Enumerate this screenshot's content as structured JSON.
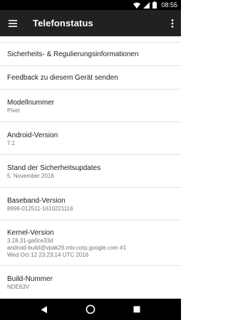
{
  "status_bar": {
    "time": "08:55",
    "icons": [
      "wifi-icon",
      "signal-icon",
      "battery-icon"
    ]
  },
  "app_bar": {
    "title": "Telefonstatus",
    "menu_icon": "hamburger-menu-icon",
    "overflow_icon": "more-vert-icon"
  },
  "items": [
    {
      "title": "Sicherheits- & Regulierungsinformationen"
    },
    {
      "title": "Feedback zu diesem Gerät senden"
    },
    {
      "title": "Modellnummer",
      "sub": "Pixel"
    },
    {
      "title": "Android-Version",
      "sub": "7.1"
    },
    {
      "title": "Stand der Sicherheitsupdates",
      "sub": "5. November 2016"
    },
    {
      "title": "Baseband-Version",
      "sub": "8996-012511-1610221116"
    },
    {
      "title": "Kernel-Version",
      "sub_lines": [
        "3.18.31-ga0ce33d",
        "android-build@vpak29.mtv.corp.google.com #1",
        "Wed Oct 12 23:23:14 UTC 2016"
      ]
    },
    {
      "title": "Build-Nummer",
      "sub": "NDE63V"
    }
  ],
  "nav_bar": {
    "icons": [
      "back-icon",
      "home-icon",
      "recents-icon"
    ]
  }
}
